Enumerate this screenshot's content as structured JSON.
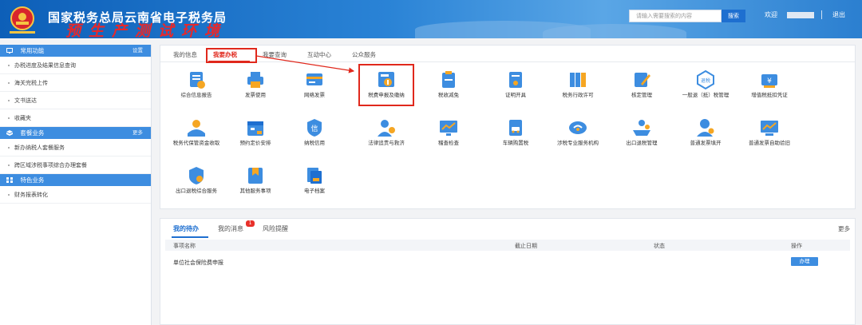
{
  "header": {
    "title": "国家税务总局云南省电子税务局",
    "subtitle": "预生产测试环境",
    "search_placeholder": "请输入需要搜索的内容",
    "search_button": "搜索",
    "welcome": "欢迎",
    "logout": "退出",
    "colors": {
      "banner": "#1a6cc8",
      "subtitle": "#e8282a"
    }
  },
  "sidebar": {
    "common": {
      "title": "常用功能",
      "action": "设置",
      "icon": "monitor-icon",
      "items": [
        "办税进度及结果信息查询",
        "海关完税上传",
        "文书送达",
        "收藏夹"
      ]
    },
    "package": {
      "title": "套餐业务",
      "action": "更多",
      "icon": "box-icon",
      "items": [
        "新办纳税人套餐服务",
        "跨区域涉税事项综合办理套餐"
      ]
    },
    "special": {
      "title": "特色业务",
      "icon": "grid-icon",
      "items": [
        "财务报表转化"
      ]
    }
  },
  "tabs": [
    "我的信息",
    "我要办税",
    "我要查询",
    "互动中心",
    "公众服务"
  ],
  "active_tab": "我要办税",
  "services": [
    {
      "label": "综合信息报告",
      "icon": "report-icon"
    },
    {
      "label": "发票使用",
      "icon": "printer-icon"
    },
    {
      "label": "网络发票",
      "icon": "card-icon"
    },
    {
      "label": "税费申报及缴纳",
      "icon": "declare-icon",
      "highlighted": true
    },
    {
      "label": "税收减免",
      "icon": "clipboard-icon"
    },
    {
      "label": "证明开具",
      "icon": "certificate-icon"
    },
    {
      "label": "税务行政许可",
      "icon": "binders-icon"
    },
    {
      "label": "核定管理",
      "icon": "edit-icon"
    },
    {
      "label": "一般退（抵）税管理",
      "icon": "refund-icon",
      "badge": "退税"
    },
    {
      "label": "增值税抵扣凭证",
      "icon": "yen-icon"
    },
    {
      "label": "税务代保管资金收取",
      "icon": "handshake-icon"
    },
    {
      "label": "预约定价安排",
      "icon": "calendar-icon"
    },
    {
      "label": "纳税信用",
      "icon": "credit-icon",
      "badge": "信"
    },
    {
      "label": "法律追责与救济",
      "icon": "lawyer-icon"
    },
    {
      "label": "稽查检查",
      "icon": "chart-icon"
    },
    {
      "label": "车辆购置税",
      "icon": "car-icon"
    },
    {
      "label": "涉税专业服务机构",
      "icon": "cloud-icon"
    },
    {
      "label": "出口退税管理",
      "icon": "ship-icon"
    },
    {
      "label": "普通发票填开",
      "icon": "person-icon"
    },
    {
      "label": "普通发票自助验旧",
      "icon": "monitor-chart-icon"
    },
    {
      "label": "出口退税综合服务",
      "icon": "shield-icon"
    },
    {
      "label": "其他服务事项",
      "icon": "bookmark-icon"
    },
    {
      "label": "电子档案",
      "icon": "archive-icon"
    }
  ],
  "todo": {
    "tabs": [
      "我的待办",
      "我的消息",
      "风险提醒"
    ],
    "message_badge": "1",
    "more": "更多",
    "columns": [
      "事项名称",
      "截止日期",
      "状态",
      "操作"
    ],
    "rows": [
      {
        "name": "单位社会保险费申报",
        "deadline": "",
        "status": "",
        "action": "办理"
      }
    ]
  }
}
